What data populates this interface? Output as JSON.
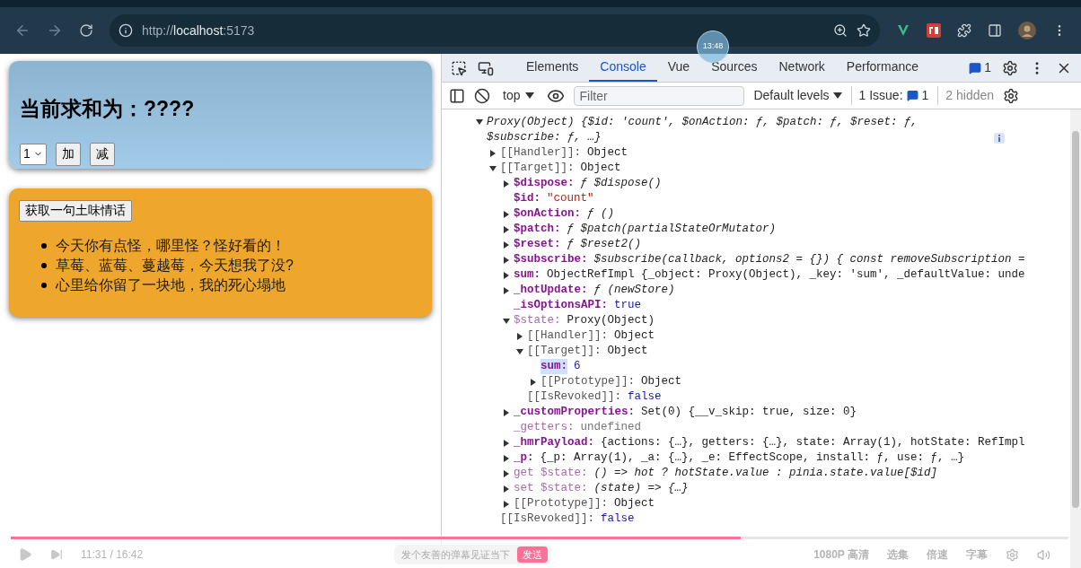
{
  "browser": {
    "url": "http://**localhost**:5173"
  },
  "page": {
    "counter_card": {
      "title": "当前求和为：????",
      "select_value": "1",
      "buttons": [
        "加",
        "减"
      ]
    },
    "talk_card": {
      "button": "获取一句土味情话",
      "items": [
        "今天你有点怪，哪里怪？怪好看的！",
        "草莓、蓝莓、蔓越莓，今天想我了没?",
        "心里给你留了一块地，我的死心塌地"
      ]
    }
  },
  "devtools": {
    "tabs": [
      {
        "label": "Elements",
        "selected": false
      },
      {
        "label": "Console",
        "selected": true
      },
      {
        "label": "Vue",
        "selected": false
      },
      {
        "label": "Sources",
        "selected": false
      },
      {
        "label": "Network",
        "selected": false
      },
      {
        "label": "Performance",
        "selected": false
      }
    ],
    "issues_badge": "1",
    "context": "top",
    "filter_placeholder": "Filter",
    "levels": "Default levels",
    "issue_label": "1 Issue:",
    "issue_count": "1",
    "hidden": "2 hidden",
    "console": [
      {
        "summary": "Proxy(Object) {$id: 'count', $onAction: ƒ, $patch: ƒ, $reset: ƒ, $subscribe: ƒ, …}",
        "expanded": true,
        "children": [
          {
            "key": "[[Handler]]:",
            "kind": "internal",
            "value": {
              "text": "Object",
              "kind": "plain"
            },
            "expanded": false
          },
          {
            "key": "[[Target]]:",
            "kind": "internal",
            "value": {
              "text": "Object",
              "kind": "plain"
            },
            "expanded": true,
            "children": [
              {
                "key": "$dispose:",
                "kind": "own",
                "value": {
                  "text": "ƒ $dispose()",
                  "kind": "function"
                },
                "expanded": false
              },
              {
                "key": "$id:",
                "kind": "own",
                "value": {
                  "text": "\"count\"",
                  "kind": "string"
                }
              },
              {
                "key": "$onAction:",
                "kind": "own",
                "value": {
                  "text": "ƒ ()",
                  "kind": "function"
                },
                "expanded": false
              },
              {
                "key": "$patch:",
                "kind": "own",
                "value": {
                  "text": "ƒ $patch(partialStateOrMutator)",
                  "kind": "function"
                },
                "expanded": false
              },
              {
                "key": "$reset:",
                "kind": "own",
                "value": {
                  "text": "ƒ $reset2()",
                  "kind": "function"
                },
                "expanded": false
              },
              {
                "key": "$subscribe:",
                "kind": "own",
                "value": {
                  "text": "$subscribe(callback, options2 = {}) { const removeSubscription =",
                  "kind": "function"
                },
                "expanded": false
              },
              {
                "key": "sum:",
                "kind": "own",
                "value": {
                  "text": "ObjectRefImpl {_object: Proxy(Object), _key: 'sum', _defaultValue: unde",
                  "kind": "plain"
                },
                "expanded": false
              },
              {
                "key": "_hotUpdate:",
                "kind": "own",
                "value": {
                  "text": "ƒ (newStore)",
                  "kind": "function"
                },
                "expanded": false
              },
              {
                "key": "_isOptionsAPI:",
                "kind": "own",
                "value": {
                  "text": "true",
                  "kind": "keyword"
                }
              },
              {
                "key": "$state:",
                "kind": "dim",
                "value": {
                  "text": "Proxy(Object)",
                  "kind": "plain"
                },
                "expanded": true,
                "children": [
                  {
                    "key": "[[Handler]]:",
                    "kind": "internal",
                    "value": {
                      "text": "Object",
                      "kind": "plain"
                    },
                    "expanded": false
                  },
                  {
                    "key": "[[Target]]:",
                    "kind": "internal",
                    "value": {
                      "text": "Object",
                      "kind": "plain"
                    },
                    "expanded": true,
                    "children": [
                      {
                        "key": "sum:",
                        "kind": "own",
                        "value": {
                          "text": "6",
                          "kind": "keyword"
                        },
                        "highlighted": true
                      },
                      {
                        "key": "[[Prototype]]:",
                        "kind": "internal",
                        "value": {
                          "text": "Object",
                          "kind": "plain"
                        },
                        "expanded": false
                      }
                    ]
                  },
                  {
                    "key": "[[IsRevoked]]:",
                    "kind": "internal",
                    "value": {
                      "text": "false",
                      "kind": "keyword"
                    }
                  }
                ]
              },
              {
                "key": "_customProperties:",
                "kind": "own",
                "value": {
                  "text": "Set(0) {__v_skip: true, size: 0}",
                  "kind": "plain"
                },
                "expanded": false
              },
              {
                "key": "_getters:",
                "kind": "dim",
                "value": {
                  "text": "undefined",
                  "kind": "undefined"
                }
              },
              {
                "key": "_hmrPayload:",
                "kind": "own",
                "value": {
                  "text": "{actions: {…}, getters: {…}, state: Array(1), hotState: RefImpl",
                  "kind": "plain"
                },
                "expanded": false
              },
              {
                "key": "_p:",
                "kind": "own",
                "value": {
                  "text": "{_p: Array(1), _a: {…}, _e: EffectScope, install: ƒ, use: ƒ, …}",
                  "kind": "plain"
                },
                "expanded": false
              },
              {
                "key": "get $state:",
                "kind": "dim",
                "value": {
                  "text": "() => hot ? hotState.value : pinia.state.value[$id]",
                  "kind": "function"
                },
                "expanded": false
              },
              {
                "key": "set $state:",
                "kind": "dim",
                "value": {
                  "text": "(state) => {…}",
                  "kind": "function"
                },
                "expanded": false
              },
              {
                "key": "[[Prototype]]:",
                "kind": "internal",
                "value": {
                  "text": "Object",
                  "kind": "plain"
                },
                "expanded": false
              }
            ]
          },
          {
            "key": "[[IsRevoked]]:",
            "kind": "internal",
            "value": {
              "text": "false",
              "kind": "keyword"
            }
          }
        ]
      }
    ]
  },
  "video": {
    "timestamp_bubble": "13:48",
    "time": "11:31 / 16:42",
    "progress": {
      "level": 0.69
    },
    "danmaku_placeholder": "发个友善的弹幕见证当下",
    "send": "发送",
    "quality": "1080P 高清",
    "episodes": "选集",
    "speed": "倍速",
    "subtitles": "字幕"
  }
}
